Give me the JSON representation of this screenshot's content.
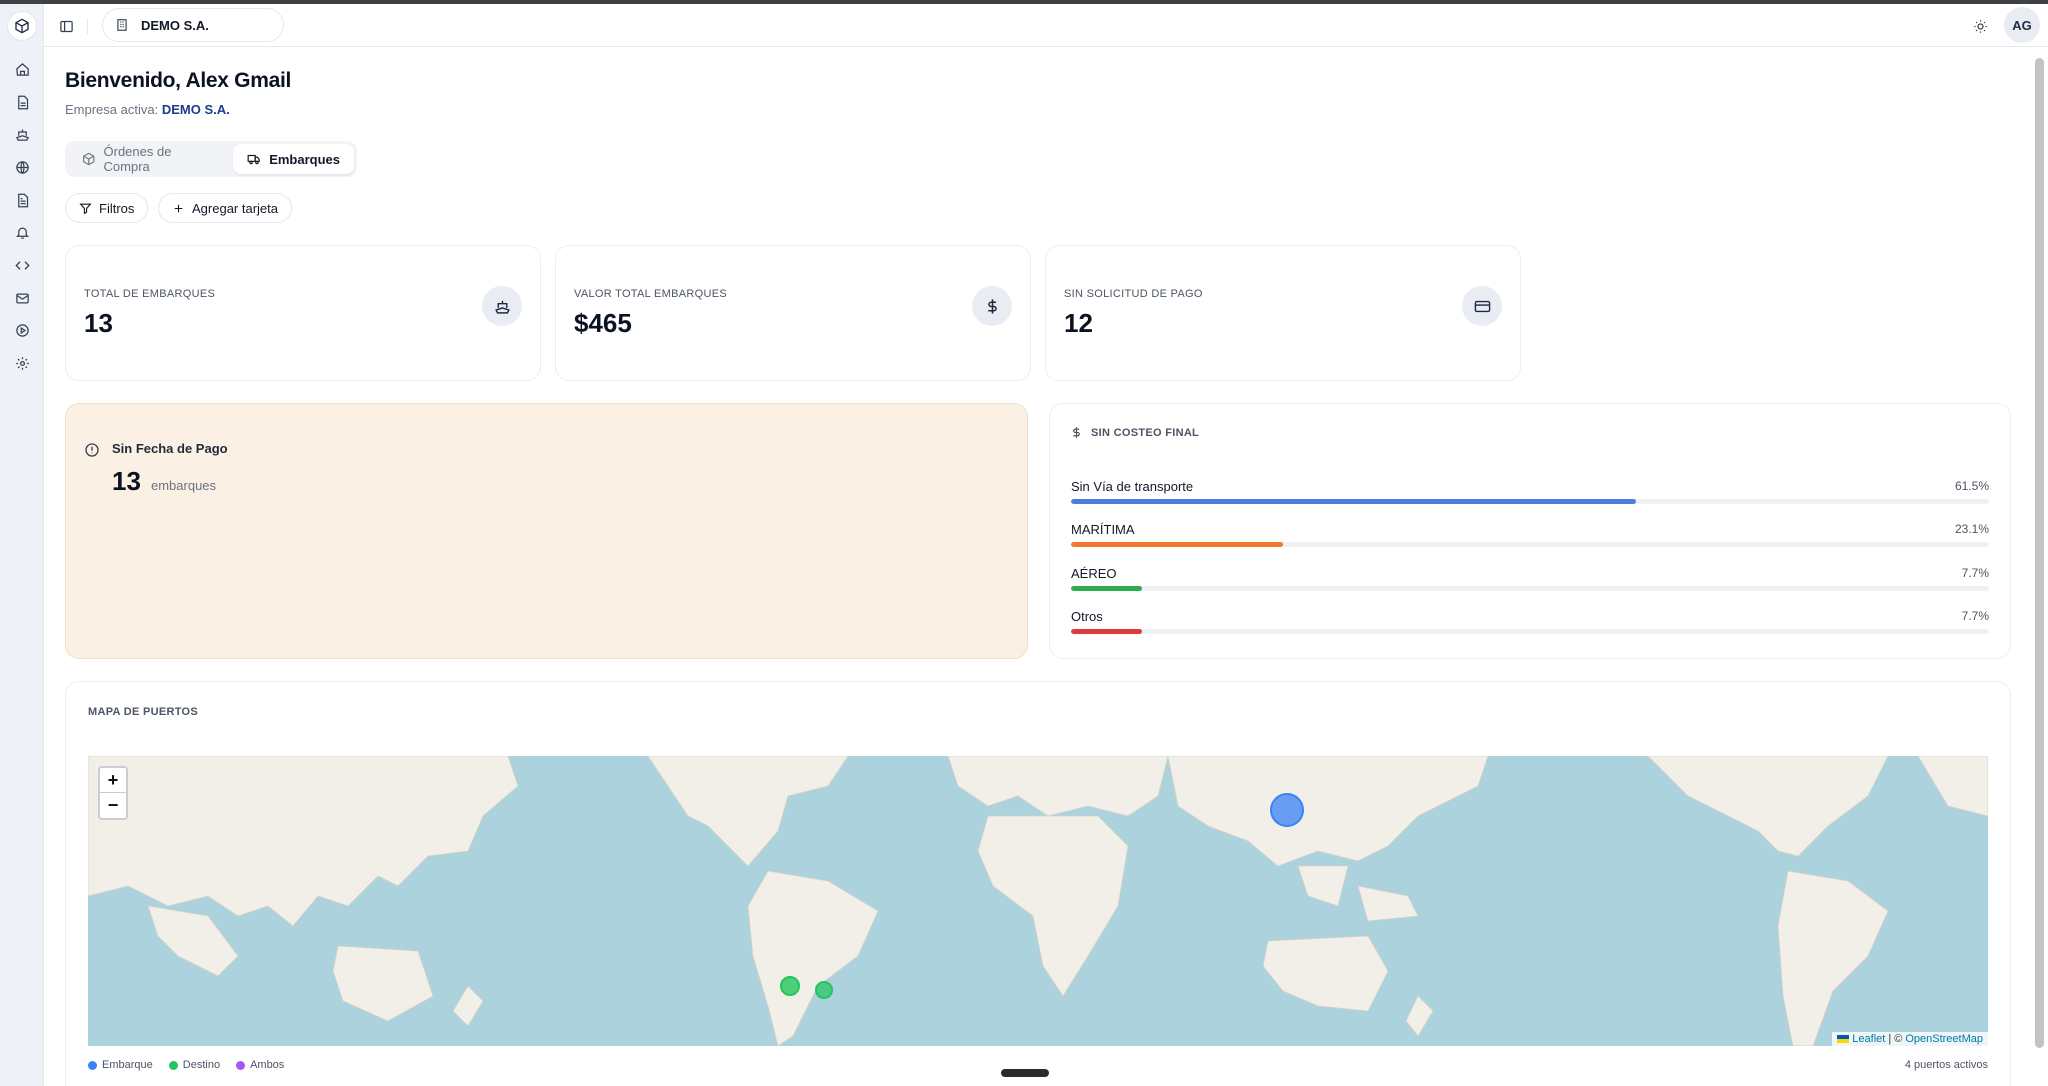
{
  "app": {
    "company_selector": "DEMO S.A.",
    "avatar_initials": "AG"
  },
  "sidebar": {
    "items": [
      {
        "icon": "home-icon"
      },
      {
        "icon": "document-icon"
      },
      {
        "icon": "ship-icon"
      },
      {
        "icon": "globe-icon"
      },
      {
        "icon": "report-icon"
      },
      {
        "icon": "bell-icon"
      },
      {
        "icon": "code-icon"
      },
      {
        "icon": "mail-icon"
      },
      {
        "icon": "play-icon"
      },
      {
        "icon": "gear-icon"
      }
    ]
  },
  "header": {
    "greeting": "Bienvenido, Alex Gmail",
    "active_company_label": "Empresa activa:",
    "active_company_value": "DEMO S.A."
  },
  "tabs": [
    {
      "label": "Órdenes de Compra",
      "active": false
    },
    {
      "label": "Embarques",
      "active": true
    }
  ],
  "toolbar": {
    "filters_label": "Filtros",
    "add_card_label": "Agregar tarjeta"
  },
  "stats": [
    {
      "label": "TOTAL DE EMBARQUES",
      "value": "13",
      "icon": "ship-icon"
    },
    {
      "label": "VALOR TOTAL EMBARQUES",
      "value": "$465",
      "icon": "dollar-icon"
    },
    {
      "label": "SIN SOLICITUD DE PAGO",
      "value": "12",
      "icon": "credit-card-icon"
    }
  ],
  "alert_card": {
    "title": "Sin Fecha de Pago",
    "value": "13",
    "unit": "embarques"
  },
  "costing": {
    "title": "SIN COSTEO FINAL",
    "rows": [
      {
        "name": "Sin Vía de transporte",
        "pct_label": "61.5%",
        "pct": 61.5,
        "color": "#4a7fe0"
      },
      {
        "name": "MARÍTIMA",
        "pct_label": "23.1%",
        "pct": 23.1,
        "color": "#ef7a2f"
      },
      {
        "name": "AÉREO",
        "pct_label": "7.7%",
        "pct": 7.7,
        "color": "#2eab4f"
      },
      {
        "name": "Otros",
        "pct_label": "7.7%",
        "pct": 7.7,
        "color": "#e03b3b"
      }
    ]
  },
  "map": {
    "title": "MAPA DE PUERTOS",
    "zoom_in": "+",
    "zoom_out": "−",
    "attribution_leaflet": "Leaflet",
    "attribution_sep": "| ©",
    "attribution_osm": "OpenStreetMap",
    "legend": [
      {
        "label": "Embarque",
        "color": "#3b82f6"
      },
      {
        "label": "Destino",
        "color": "#22c55e"
      },
      {
        "label": "Ambos",
        "color": "#a855f7"
      }
    ],
    "ports_active": "4 puertos activos"
  }
}
